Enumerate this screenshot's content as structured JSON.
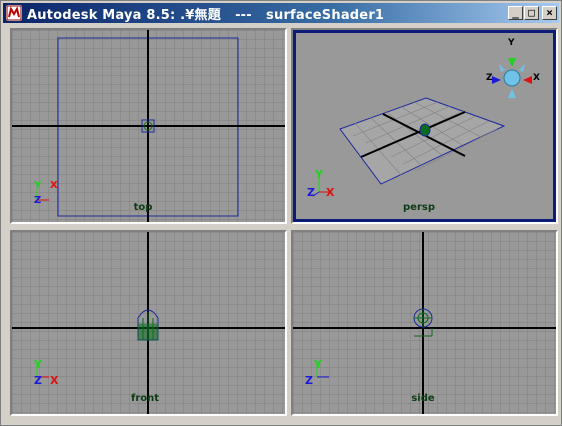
{
  "window": {
    "title": "Autodesk Maya 8.5: .¥無題   ---   surfaceShader1",
    "minimize_glyph": "_",
    "maximize_glyph": "□",
    "close_glyph": "×"
  },
  "viewports": {
    "top": {
      "label": "top",
      "axis_a": "Y",
      "axis_b": "X",
      "axis_c": "Z"
    },
    "persp": {
      "label": "persp",
      "axis_a": "Y",
      "axis_b": "X",
      "axis_c": "Z",
      "gizmo_y": "Y",
      "gizmo_x": "X",
      "gizmo_z": "Z"
    },
    "front": {
      "label": "front",
      "axis_a": "Y",
      "axis_b": "X",
      "axis_c": "Z"
    },
    "side": {
      "label": "side",
      "axis_a": "Y",
      "axis_b": "Z"
    }
  },
  "colors": {
    "grid_bg": "#999999",
    "grid_line": "#7f7f7f",
    "axis_line": "#000000",
    "active_border": "#0b1d78",
    "object_green": "#0a6b1f",
    "object_blue": "#1b2a9a",
    "axis_x": "#e01010",
    "axis_y": "#1fd21f",
    "axis_z": "#1a1ad8"
  }
}
